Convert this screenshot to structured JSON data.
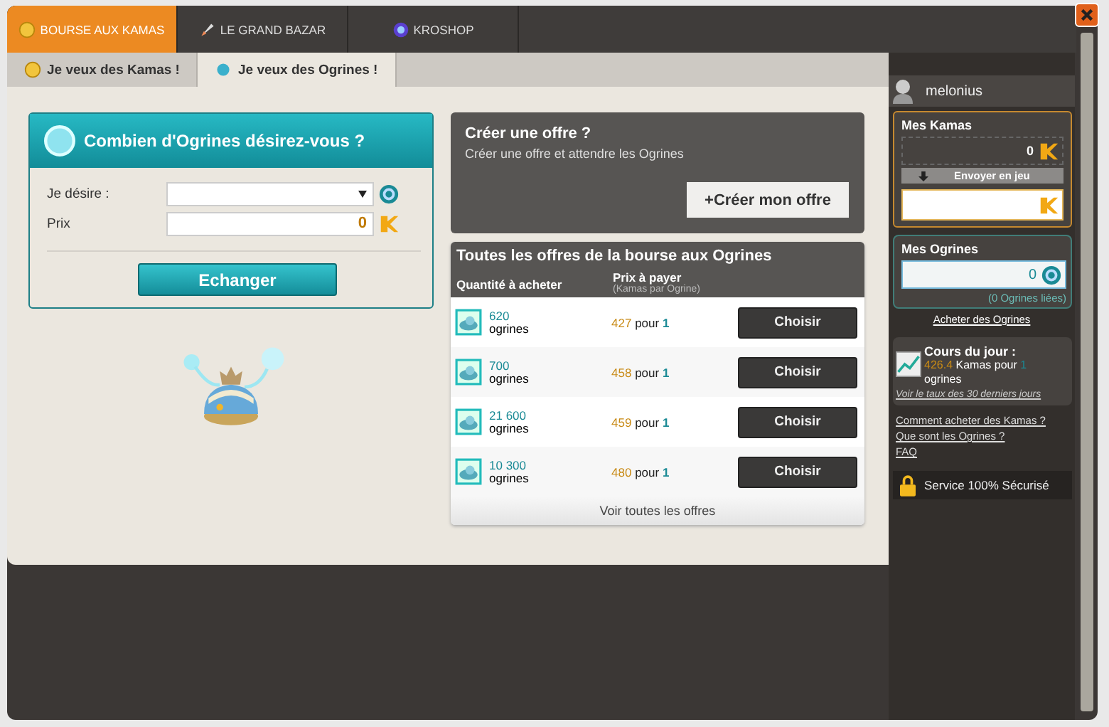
{
  "main_tabs": [
    {
      "label": "BOURSE AUX KAMAS",
      "selected": true
    },
    {
      "label": "LE GRAND BAZAR",
      "selected": false
    },
    {
      "label": "KROSHOP",
      "selected": false
    }
  ],
  "sub_tabs": [
    {
      "label": "Je veux des Kamas !",
      "selected": false
    },
    {
      "label": "Je veux des Ogrines !",
      "selected": true
    }
  ],
  "order_form": {
    "title": "Combien d'Ogrines désirez-vous ?",
    "desire_label": "Je désire :",
    "price_label": "Prix",
    "price_value": "0",
    "button": "Echanger"
  },
  "create_offer": {
    "title": "Créer une offre ?",
    "text": "Créer une offre et attendre les Ogrines",
    "button": "+Créer mon offre"
  },
  "offers": {
    "title": "Toutes les offres de la bourse aux Ogrines",
    "col_quantity": "Quantité à acheter",
    "col_price": "Prix à payer",
    "col_price_note": "(Kamas par Ogrine)",
    "rows": [
      {
        "quantity": "620",
        "unit": "ogrines",
        "price": "427",
        "per": "pour",
        "per_count": "1",
        "button": "Choisir"
      },
      {
        "quantity": "700",
        "unit": "ogrines",
        "price": "458",
        "per": "pour",
        "per_count": "1",
        "button": "Choisir"
      },
      {
        "quantity": "21 600",
        "unit": "ogrines",
        "price": "459",
        "per": "pour",
        "per_count": "1",
        "button": "Choisir"
      },
      {
        "quantity": "10 300",
        "unit": "ogrines",
        "price": "480",
        "per": "pour",
        "per_count": "1",
        "button": "Choisir"
      }
    ],
    "see_all": "Voir toutes les offres"
  },
  "sidebar": {
    "username": "melonius",
    "kamas_title": "Mes Kamas",
    "kamas_value": "0",
    "send_button": "Envoyer en jeu",
    "ogrines_title": "Mes Ogrines",
    "ogrines_value": "0",
    "ogrines_bound": "(0 Ogrines liées)",
    "buy_link": "Acheter des Ogrines",
    "rate_title": "Cours du jour :",
    "rate_value": "426.4",
    "rate_text": "Kamas pour",
    "rate_count": "1",
    "rate_unit": "ogrines",
    "rate_link": "Voir le taux des 30 derniers jours",
    "links": [
      "Comment acheter des Kamas ?",
      "Que sont les Ogrines ?",
      "FAQ"
    ],
    "secure": "Service 100% Sécurisé"
  }
}
